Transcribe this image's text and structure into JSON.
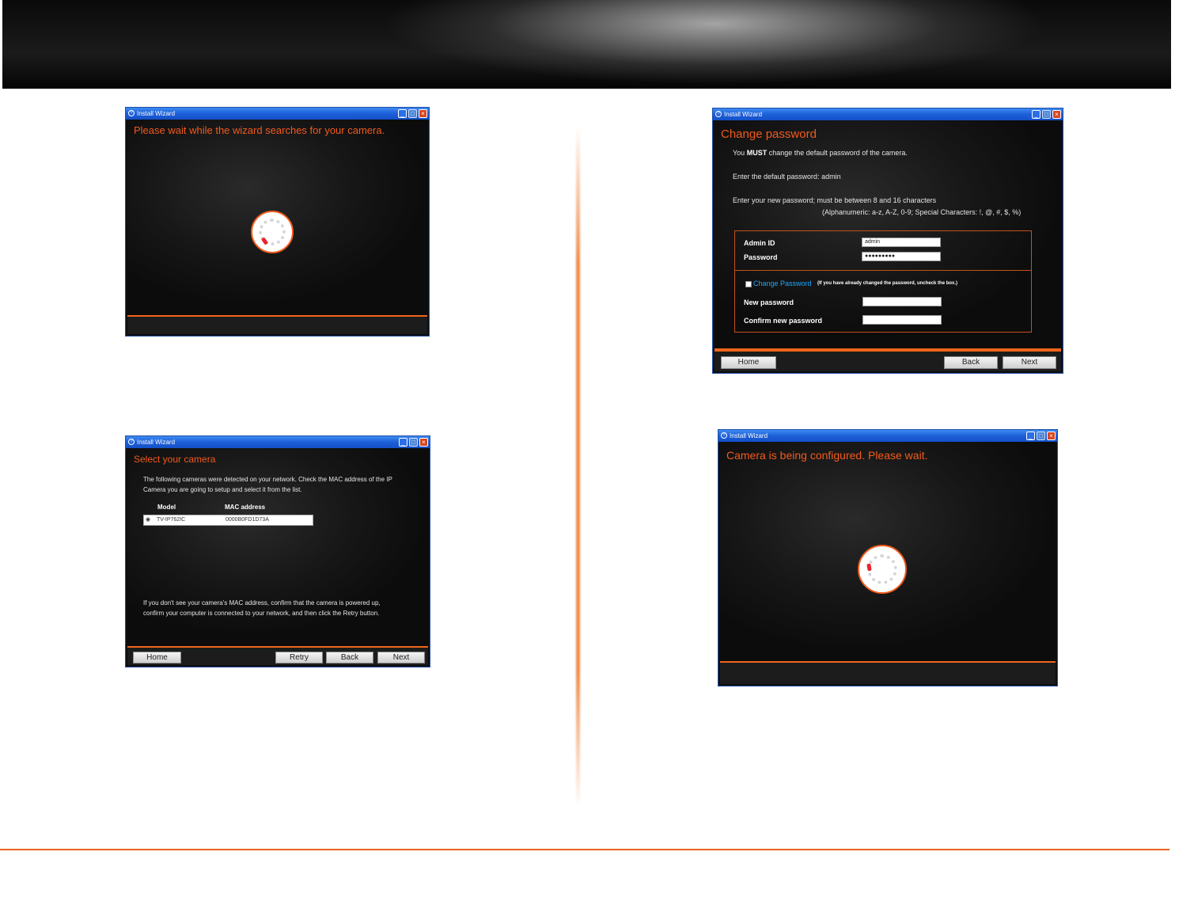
{
  "windows": {
    "search": {
      "title": "Install Wizard",
      "heading": "Please wait while the wizard searches for your camera."
    },
    "select": {
      "title": "Install Wizard",
      "heading": "Select your camera",
      "intro_line1": "The following cameras were detected on your network. Check the MAC address of the IP",
      "intro_line2": "Camera you are going to setup and select it from the list.",
      "columns": {
        "model": "Model",
        "mac": "MAC address"
      },
      "rows": [
        {
          "radio": "◉",
          "model": "TV-IP762IC",
          "mac": "0000B0FD1D73A"
        }
      ],
      "help_line1": "If you don't see your camera's MAC address, confirm that the camera is powered up,",
      "help_line2": "confirm your computer is connected to your network, and then click the Retry button.",
      "buttons": {
        "home": "Home",
        "retry": "Retry",
        "back": "Back",
        "next": "Next"
      }
    },
    "password": {
      "title": "Install Wizard",
      "heading": "Change password",
      "line1_prefix": "You",
      "line1_must": "MUST",
      "line1_suffix": "change the default password of the camera.",
      "line2": "Enter the default password: admin",
      "line3": "Enter your new password; must be between 8 and 16 characters",
      "line4": "(Alphanumeric: a-z, A-Z, 0-9; Special Characters: !, @, #, $, %)",
      "admin_id_label": "Admin ID",
      "admin_id_value": "admin",
      "password_label": "Password",
      "password_value": "●●●●●●●●●",
      "change_password_link": "Change Password",
      "change_password_note": "(If you have already changed the password, uncheck the box.)",
      "new_password_label": "New password",
      "confirm_password_label": "Confirm new password",
      "buttons": {
        "home": "Home",
        "back": "Back",
        "next": "Next"
      }
    },
    "configuring": {
      "title": "Install Wizard",
      "heading": "Camera is being configured. Please wait."
    }
  }
}
